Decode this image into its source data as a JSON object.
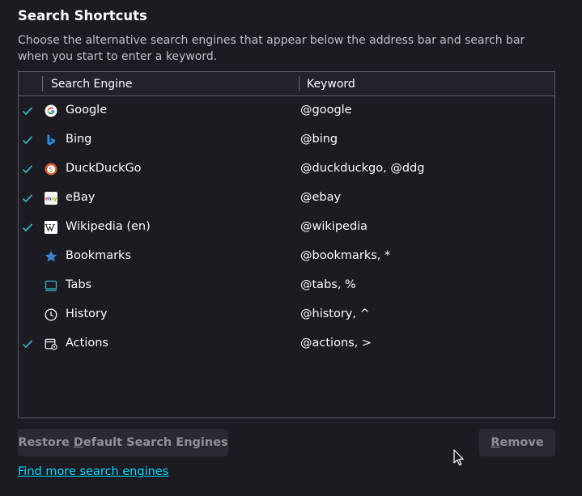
{
  "section": {
    "title": "Search Shortcuts",
    "description": "Choose the alternative search engines that appear below the address bar and search bar when you start to enter a keyword."
  },
  "table": {
    "columns": [
      "Search Engine",
      "Keyword"
    ],
    "rows": [
      {
        "name": "Google",
        "keyword": "@google",
        "checked": true,
        "icon": "google-icon"
      },
      {
        "name": "Bing",
        "keyword": "@bing",
        "checked": true,
        "icon": "bing-icon"
      },
      {
        "name": "DuckDuckGo",
        "keyword": "@duckduckgo, @ddg",
        "checked": true,
        "icon": "duckduckgo-icon"
      },
      {
        "name": "eBay",
        "keyword": "@ebay",
        "checked": true,
        "icon": "ebay-icon"
      },
      {
        "name": "Wikipedia (en)",
        "keyword": "@wikipedia",
        "checked": true,
        "icon": "wikipedia-icon"
      },
      {
        "name": "Bookmarks",
        "keyword": "@bookmarks, *",
        "checked": false,
        "icon": "star-icon"
      },
      {
        "name": "Tabs",
        "keyword": "@tabs, %",
        "checked": false,
        "icon": "tabs-icon"
      },
      {
        "name": "History",
        "keyword": "@history, ^",
        "checked": false,
        "icon": "clock-icon"
      },
      {
        "name": "Actions",
        "keyword": "@actions, >",
        "checked": true,
        "icon": "actions-icon"
      }
    ]
  },
  "buttons": {
    "restore_pre": "Restore ",
    "restore_key": "D",
    "restore_post": "efault Search Engines",
    "remove_key": "R",
    "remove_post": "emove"
  },
  "link": {
    "find_more": "Find more search engines"
  },
  "colors": {
    "background": "#1c1b22",
    "accent": "#00ddff",
    "check": "#36b3c4",
    "border": "#5b5b66"
  }
}
